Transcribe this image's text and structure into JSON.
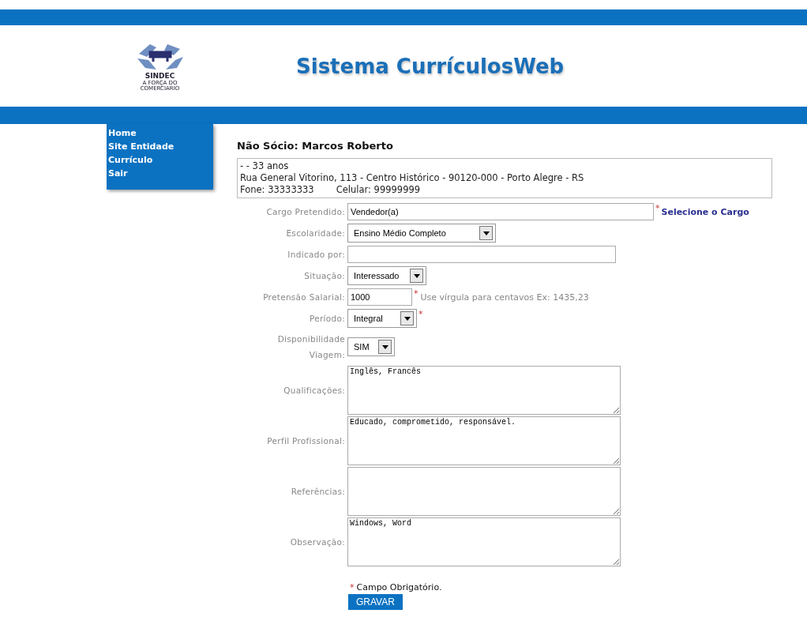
{
  "header": {
    "logo_lines": [
      "SINDEC",
      "A FORÇA DO",
      "COMERCIARIO"
    ],
    "title": "Sistema CurrículosWeb"
  },
  "menu": [
    {
      "label": "Home"
    },
    {
      "label": "Site Entidade"
    },
    {
      "label": "Currículo"
    },
    {
      "label": "Sair"
    }
  ],
  "heading": "Não Sócio: Marcos Roberto",
  "info": {
    "line1": "- - 33 anos",
    "line2": "Rua General Vitorino, 113 - Centro Histórico - 90120-000 - Porto Alegre - RS",
    "phone": "Fone: 33333333",
    "mobile": "Celular: 99999999"
  },
  "fields": [
    {
      "kind": "text",
      "label": "Cargo Pretendido:",
      "value": "Vendedor(a)",
      "marker": "*",
      "link": "Selecione o Cargo"
    },
    {
      "kind": "select",
      "label": "Escolaridade:",
      "value": "Ensino Médio Completo"
    },
    {
      "kind": "text",
      "label": "Indicado por:"
    },
    {
      "kind": "select",
      "label": "Situação:",
      "value": "Interessado"
    },
    {
      "kind": "text",
      "label": "Pretensão Salarial:",
      "value": "1000",
      "marker": "*",
      "hint": "Use vírgula para centavos Ex: 1435,23"
    },
    {
      "kind": "select",
      "label": "Período:",
      "value": "Integral",
      "marker": "*"
    },
    {
      "kind": "select",
      "label": "Disponibilidade Viagem:",
      "value": "SIM"
    },
    {
      "kind": "textarea",
      "label": "Qualificações:",
      "value": "Inglês, Francês"
    },
    {
      "kind": "textarea",
      "label": "Perfil Profissional:",
      "value": "Educado, comprometido, responsável."
    },
    {
      "kind": "textarea",
      "label": "Referências:"
    },
    {
      "kind": "textarea",
      "label": "Observação:",
      "value": "Windows, Word"
    }
  ],
  "note_marker": "*",
  "note": "Campo Obrigatório.",
  "submit": "GRAVAR"
}
